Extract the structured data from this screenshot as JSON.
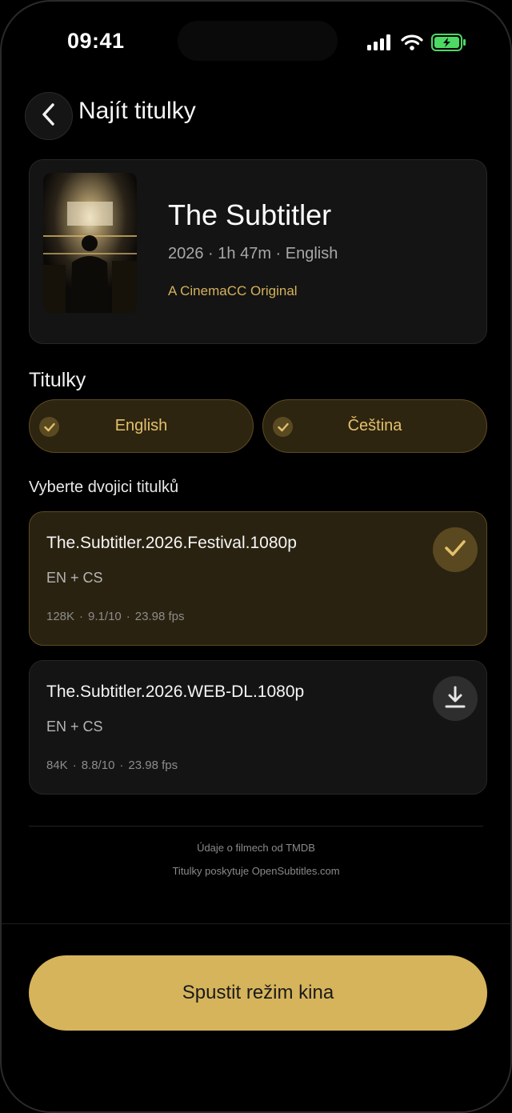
{
  "status_bar": {
    "time": "09:41"
  },
  "header": {
    "title": "Najít titulky"
  },
  "movie": {
    "title": "The Subtitler",
    "meta": "2026 · 1h 47m · English",
    "original": "A CinemaCC Original"
  },
  "subtitles_section": {
    "title": "Titulky",
    "languages": [
      {
        "label": "English",
        "selected": true
      },
      {
        "label": "Čeština",
        "selected": true
      }
    ]
  },
  "pair_section": {
    "title": "Vyberte dvojici titulků",
    "items": [
      {
        "name": "The.Subtitler.2026.Festival.1080p",
        "langs": "EN + CS",
        "downloads": "128K",
        "rating": "9.1/10",
        "fps": "23.98 fps",
        "selected": true,
        "action_icon": "check-icon"
      },
      {
        "name": "The.Subtitler.2026.WEB-DL.1080p",
        "langs": "EN + CS",
        "downloads": "84K",
        "rating": "8.8/10",
        "fps": "23.98 fps",
        "selected": false,
        "action_icon": "download-icon"
      }
    ]
  },
  "credits": {
    "line1": "Údaje o filmech od TMDB",
    "line2": "Titulky poskytuje OpenSubtitles.com"
  },
  "cta": {
    "label": "Spustit režim kina"
  },
  "colors": {
    "accent": "#d6b45c",
    "background": "#000000",
    "card": "#141414"
  }
}
